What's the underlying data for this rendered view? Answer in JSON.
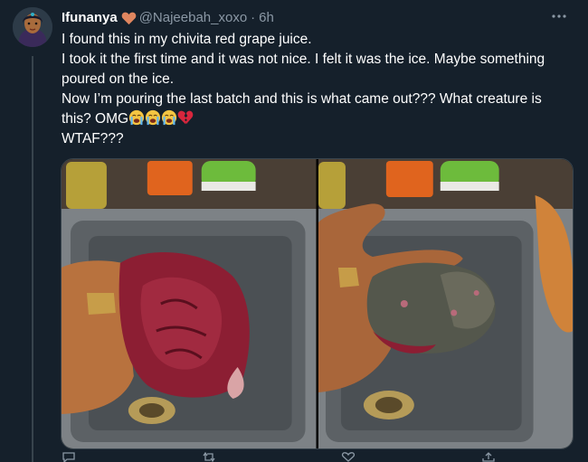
{
  "tweet": {
    "display_name": "Ifunanya",
    "handle": "@Najeebah_xoxo",
    "separator": "·",
    "time": "6h",
    "lines": [
      "I found this in my chivita red grape juice.",
      "I took it the first time and it was not nice. I felt it was the ice. Maybe something poured on the ice.",
      "Now I’m pouring the last batch and this is what came out??? What creature is this? OMG",
      "WTAF???"
    ],
    "icons": {
      "name_badge": "orange-heart-icon",
      "emojis": [
        "loudly-crying-face-emoji",
        "loudly-crying-face-emoji",
        "loudly-crying-face-emoji",
        "broken-heart-emoji"
      ],
      "menu": "more-options-icon"
    },
    "media": [
      {
        "alt_name": "photo-red-blob-in-hand"
      },
      {
        "alt_name": "photo-gray-blob-in-hand"
      }
    ]
  },
  "colors": {
    "background": "#15202b",
    "secondary_text": "#8b98a5",
    "border": "#38444d",
    "heart": "#e0865f",
    "broken_heart": "#d7263d"
  }
}
